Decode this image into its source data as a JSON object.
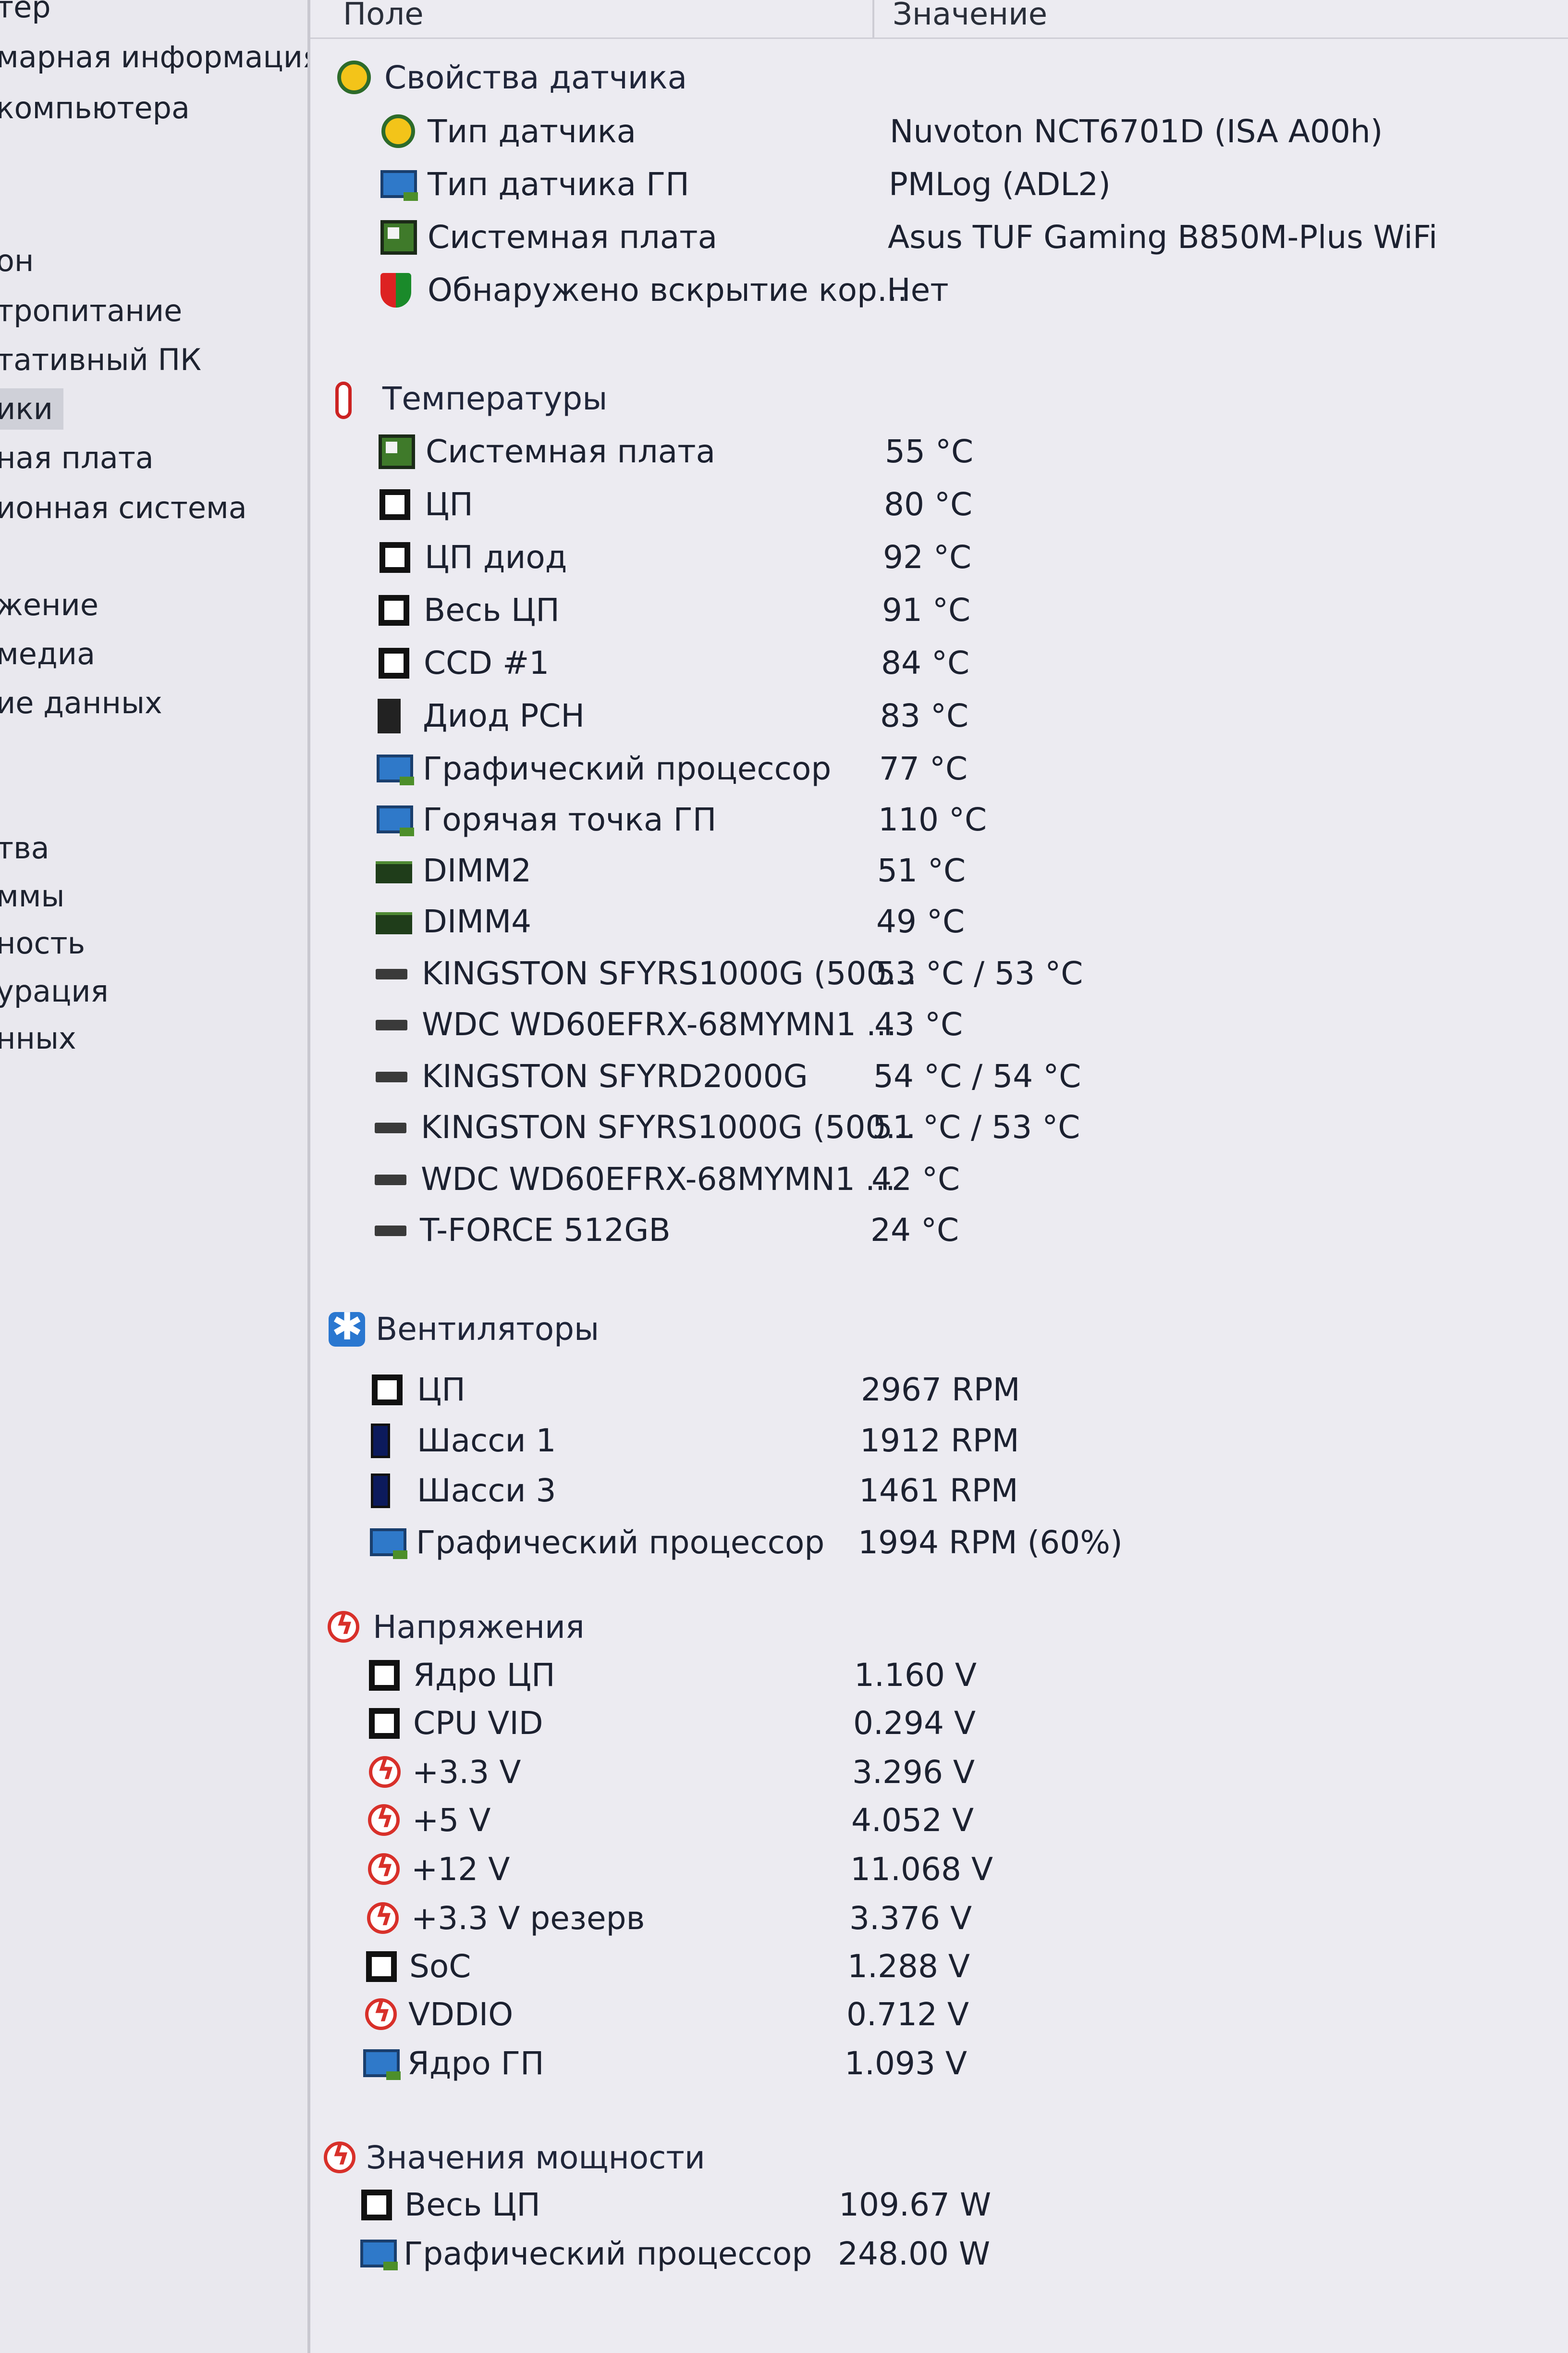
{
  "sidebar": {
    "items": [
      {
        "label": "тер"
      },
      {
        "label": "марная информация"
      },
      {
        "label": "компьютера"
      },
      {
        "label": "он"
      },
      {
        "label": "тропитание"
      },
      {
        "label": "тативный ПК"
      },
      {
        "label": "ики"
      },
      {
        "label": "ная плата"
      },
      {
        "label": "ионная система"
      },
      {
        "label": "жение"
      },
      {
        "label": "медиа"
      },
      {
        "label": "ие данных"
      },
      {
        "label": "тва"
      },
      {
        "label": "ммы"
      },
      {
        "label": "ность"
      },
      {
        "label": "урация"
      },
      {
        "label": "нных"
      }
    ]
  },
  "header": {
    "field": "Поле",
    "value": "Значение"
  },
  "groups": {
    "sensor_props": {
      "label": "Свойства датчика"
    },
    "temps": {
      "label": "Температуры"
    },
    "fans": {
      "label": "Вентиляторы"
    },
    "voltages": {
      "label": "Напряжения"
    },
    "power": {
      "label": "Значения мощности"
    }
  },
  "rows": [
    {
      "label": "Тип датчика",
      "value": "Nuvoton NCT6701D  (ISA A00h)",
      "icon": "sensor-icon"
    },
    {
      "label": "Тип датчика ГП",
      "value": "PMLog  (ADL2)",
      "icon": "monitor-icon"
    },
    {
      "label": "Системная плата",
      "value": "Asus TUF Gaming B850M-Plus WiFi",
      "icon": "motherboard-icon"
    },
    {
      "label": "Обнаружено вскрытие кор...",
      "value": "Нет",
      "icon": "shield-icon"
    },
    {
      "label": "Системная плата",
      "value": "55 °C",
      "icon": "motherboard-icon"
    },
    {
      "label": "ЦП",
      "value": "80 °C",
      "icon": "cpu-icon"
    },
    {
      "label": "ЦП диод",
      "value": "92 °C",
      "icon": "cpu-icon"
    },
    {
      "label": "Весь ЦП",
      "value": "91 °C",
      "icon": "cpu-icon"
    },
    {
      "label": "CCD #1",
      "value": "84 °C",
      "icon": "cpu-icon"
    },
    {
      "label": "Диод PCH",
      "value": "83 °C",
      "icon": "pch-icon"
    },
    {
      "label": "Графический процессор",
      "value": "77 °C",
      "icon": "monitor-icon"
    },
    {
      "label": "Горячая точка ГП",
      "value": "110 °C",
      "icon": "monitor-icon"
    },
    {
      "label": "DIMM2",
      "value": "51 °C",
      "icon": "dimm-icon"
    },
    {
      "label": "DIMM4",
      "value": "49 °C",
      "icon": "dimm-icon"
    },
    {
      "label": "KINGSTON SFYRS1000G (500...",
      "value": "53 °C / 53 °C",
      "icon": "drive-icon"
    },
    {
      "label": "WDC WD60EFRX-68MYMN1 ...",
      "value": "43 °C",
      "icon": "drive-icon"
    },
    {
      "label": "KINGSTON SFYRD2000G",
      "value": "54 °C / 54 °C",
      "icon": "drive-icon"
    },
    {
      "label": "KINGSTON SFYRS1000G (500...",
      "value": "51 °C / 53 °C",
      "icon": "drive-icon"
    },
    {
      "label": "WDC WD60EFRX-68MYMN1 ...",
      "value": "42 °C",
      "icon": "drive-icon"
    },
    {
      "label": "T-FORCE 512GB",
      "value": "24 °C",
      "icon": "drive-icon"
    },
    {
      "label": "ЦП",
      "value": "2967 RPM",
      "icon": "cpu-icon"
    },
    {
      "label": "Шасси 1",
      "value": "1912 RPM",
      "icon": "case-icon"
    },
    {
      "label": "Шасси 3",
      "value": "1461 RPM",
      "icon": "case-icon"
    },
    {
      "label": "Графический процессор",
      "value": "1994 RPM  (60%)",
      "icon": "monitor-icon"
    },
    {
      "label": "Ядро ЦП",
      "value": "1.160 V",
      "icon": "cpu-icon"
    },
    {
      "label": "CPU VID",
      "value": "0.294 V",
      "icon": "cpu-icon"
    },
    {
      "label": "+3.3 V",
      "value": "3.296 V",
      "icon": "voltage-icon"
    },
    {
      "label": "+5 V",
      "value": "4.052 V",
      "icon": "voltage-icon"
    },
    {
      "label": "+12 V",
      "value": "11.068 V",
      "icon": "voltage-icon"
    },
    {
      "label": "+3.3 V резерв",
      "value": "3.376 V",
      "icon": "voltage-icon"
    },
    {
      "label": "SoC",
      "value": "1.288 V",
      "icon": "cpu-icon"
    },
    {
      "label": "VDDIO",
      "value": "0.712 V",
      "icon": "voltage-icon"
    },
    {
      "label": "Ядро ГП",
      "value": "1.093 V",
      "icon": "monitor-icon"
    },
    {
      "label": "Весь ЦП",
      "value": "109.67 W",
      "icon": "cpu-icon"
    },
    {
      "label": "Графический процессор",
      "value": "248.00 W",
      "icon": "monitor-icon"
    }
  ]
}
